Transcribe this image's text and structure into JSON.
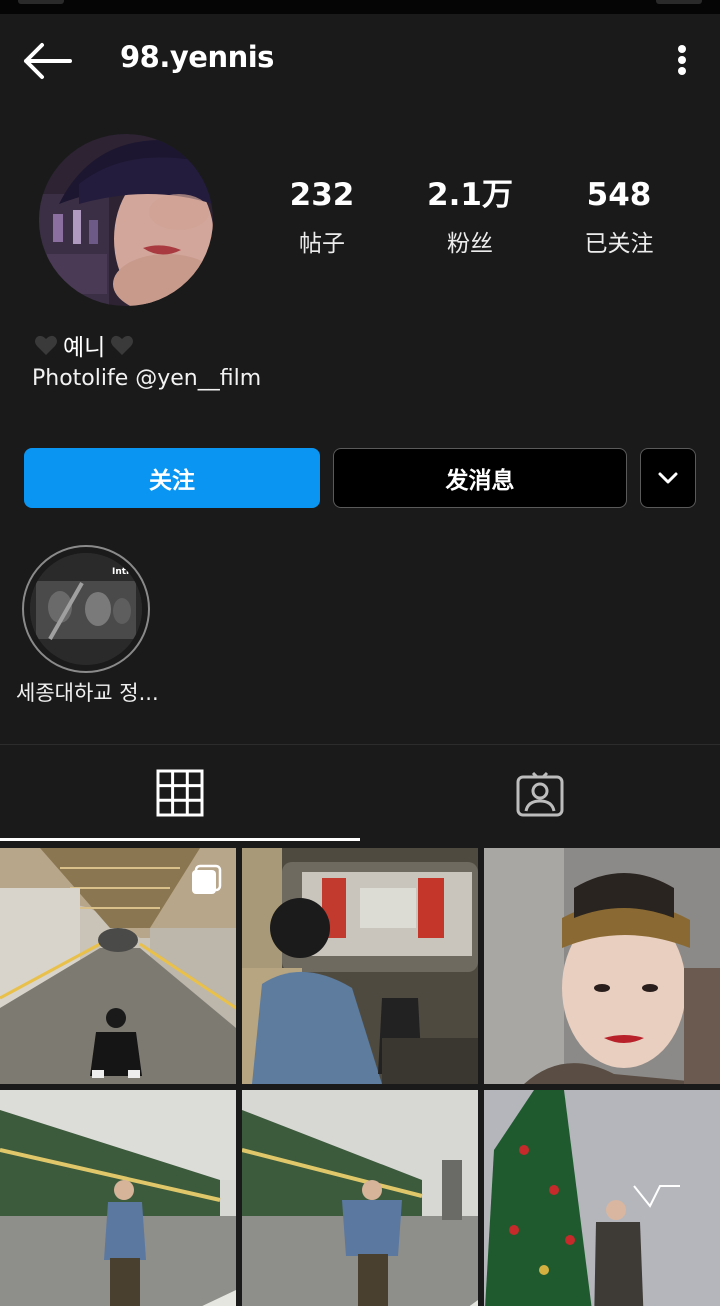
{
  "header": {
    "username": "98.yennis",
    "back_icon": "arrow-left-icon",
    "more_icon": "more-vertical-icon"
  },
  "profile": {
    "stats": [
      {
        "value": "232",
        "label": "帖子"
      },
      {
        "value": "2.1万",
        "label": "粉丝"
      },
      {
        "value": "548",
        "label": "已关注"
      }
    ],
    "display_name": "예니",
    "bio": "Photolife @yen__film"
  },
  "actions": {
    "follow_label": "关注",
    "message_label": "发消息",
    "dropdown_icon": "chevron-down-icon"
  },
  "highlights": [
    {
      "label": "세종대하교 정...",
      "cover_text": "Intr"
    }
  ],
  "tabs": [
    {
      "name": "posts-grid",
      "icon": "grid-icon",
      "active": true
    },
    {
      "name": "tagged",
      "icon": "tagged-person-icon",
      "active": false
    }
  ],
  "posts": [
    {
      "subject": "person-in-corridor",
      "multi_photo": true
    },
    {
      "subject": "person-in-car",
      "multi_photo": false
    },
    {
      "subject": "portrait-with-headband",
      "multi_photo": false
    },
    {
      "subject": "person-by-train",
      "multi_photo": false
    },
    {
      "subject": "person-by-train",
      "multi_photo": false
    },
    {
      "subject": "person-by-christmas-tree",
      "multi_photo": false
    }
  ],
  "colors": {
    "background": "#1a1a1a",
    "accent": "#0b95f2",
    "text": "#ffffff"
  }
}
